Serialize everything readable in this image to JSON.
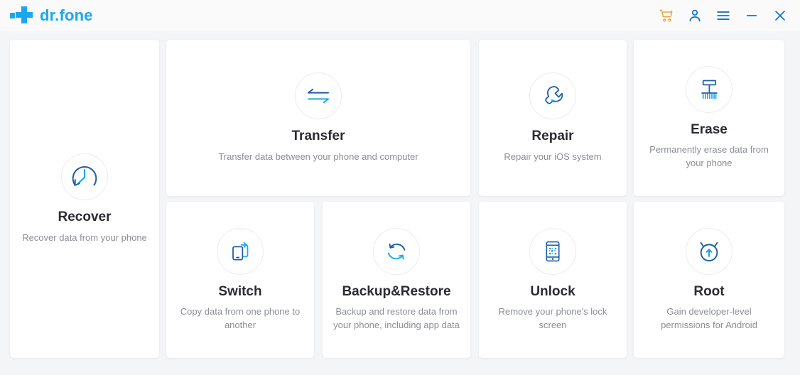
{
  "window": {
    "brand_name": "dr.fone",
    "brand_color": "#1ba7ef",
    "cart_color": "#e8a33d",
    "icon_color": "#1473c4",
    "titlebar_bg": "#fafafa",
    "page_bg": "#f4f5f6",
    "controls": [
      {
        "name": "cart-icon",
        "label": "Cart"
      },
      {
        "name": "account-icon",
        "label": "Account"
      },
      {
        "name": "menu-icon",
        "label": "Menu"
      },
      {
        "name": "minimize-icon",
        "label": "Minimize"
      },
      {
        "name": "close-icon",
        "label": "Close"
      }
    ]
  },
  "cards": [
    {
      "id": "recover",
      "icon": "recover-clock-icon",
      "title": "Recover",
      "desc": "Recover data from your phone"
    },
    {
      "id": "transfer",
      "icon": "transfer-arrows-icon",
      "title": "Transfer",
      "desc": "Transfer data between your phone and computer"
    },
    {
      "id": "repair",
      "icon": "repair-wrench-icon",
      "title": "Repair",
      "desc": "Repair your iOS system"
    },
    {
      "id": "erase",
      "icon": "erase-broom-icon",
      "title": "Erase",
      "desc": "Permanently erase data from your phone"
    },
    {
      "id": "switch",
      "icon": "switch-phones-icon",
      "title": "Switch",
      "desc": "Copy data from one phone to another"
    },
    {
      "id": "backup",
      "icon": "backup-restore-sync-icon",
      "title": "Backup&Restore",
      "desc": "Backup and restore data from your phone, including app data"
    },
    {
      "id": "unlock",
      "icon": "unlock-phone-code-icon",
      "title": "Unlock",
      "desc": "Remove your phone's lock screen"
    },
    {
      "id": "root",
      "icon": "root-android-icon",
      "title": "Root",
      "desc": "Gain developer-level permissions for Android"
    }
  ]
}
